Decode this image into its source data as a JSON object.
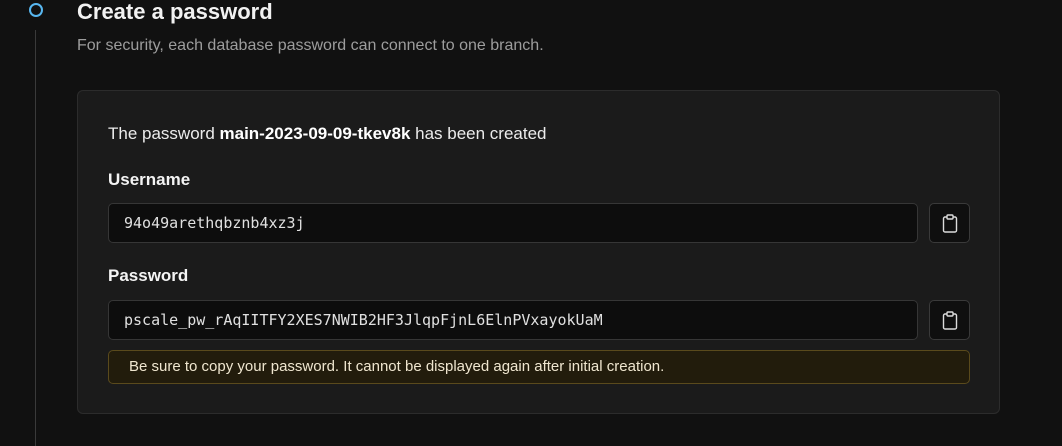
{
  "step": {
    "title": "Create a password",
    "subtitle": "For security, each database password can connect to one branch.",
    "accent_color": "#58b7f0"
  },
  "card": {
    "created_prefix": "The password ",
    "password_name": "main-2023-09-09-tkev8k",
    "created_suffix": " has been created",
    "username": {
      "label": "Username",
      "value": "94o49arethqbznb4xz3j",
      "copy_icon": "clipboard-icon"
    },
    "password": {
      "label": "Password",
      "value": "pscale_pw_rAqIITFY2XES7NWIB2HF3JlqpFjnL6ElnPVxayokUaM",
      "copy_icon": "clipboard-icon"
    },
    "warning": {
      "text": "Be sure to copy your password. It cannot be displayed again after initial creation.",
      "color": "#5a4a1c"
    }
  }
}
